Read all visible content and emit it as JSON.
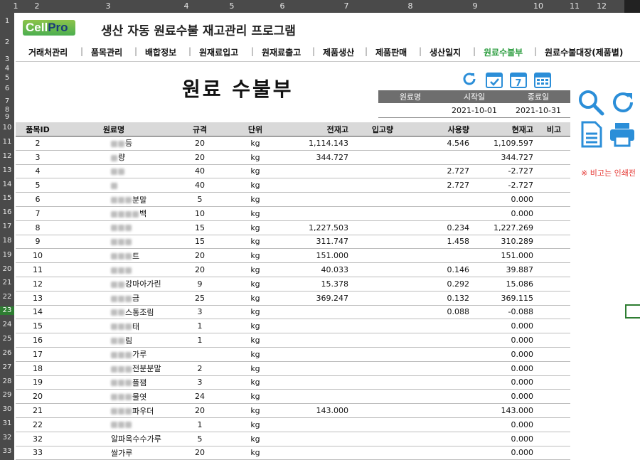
{
  "sheet": {
    "columns": [
      "1",
      "2",
      "3",
      "4",
      "5",
      "6",
      "7",
      "8",
      "9",
      "10",
      "11",
      "12"
    ],
    "rows": [
      "1",
      "2",
      "3",
      "4",
      "5",
      "6",
      "7",
      "8",
      "9",
      "10",
      "11",
      "12",
      "13",
      "14",
      "15",
      "16",
      "17",
      "18",
      "19",
      "20",
      "21",
      "22",
      "23",
      "24",
      "25",
      "26",
      "27",
      "28",
      "29",
      "30",
      "31",
      "32",
      "33"
    ],
    "active_row": "23"
  },
  "app": {
    "logo_prefix": "Cell",
    "logo_suffix": "Pro",
    "title": "생산 자동 원료수불 재고관리 프로그램"
  },
  "menu": [
    {
      "label": "거래처관리"
    },
    {
      "label": "품목관리"
    },
    {
      "label": "배합정보"
    },
    {
      "label": "원재료입고"
    },
    {
      "label": "원재료출고"
    },
    {
      "label": "제품생산"
    },
    {
      "label": "제품판매"
    },
    {
      "label": "생산일지"
    },
    {
      "label": "원료수불부",
      "active": true
    },
    {
      "label": "원료수불대장(제품별)"
    }
  ],
  "page": {
    "title": "원료 수불부",
    "period": {
      "headers": [
        "원료명",
        "시작일",
        "종료일"
      ],
      "start": "2021-10-01",
      "end": "2021-10-31"
    },
    "note": "※ 비고는 인쇄전"
  },
  "table": {
    "headers": [
      "품목ID",
      "원료명",
      "규격",
      "단위",
      "전재고",
      "입고량",
      "사용량",
      "현재고",
      "비고"
    ],
    "rows": [
      {
        "id": "2",
        "name": "등",
        "blur": 2,
        "spec": "20",
        "unit": "kg",
        "prev": "1,114.143",
        "in": "",
        "used": "4.546",
        "cur": "1,109.597"
      },
      {
        "id": "3",
        "name": "량",
        "blur": 1,
        "spec": "20",
        "unit": "kg",
        "prev": "344.727",
        "in": "",
        "used": "",
        "cur": "344.727"
      },
      {
        "id": "4",
        "name": "",
        "blur": 2,
        "spec": "40",
        "unit": "kg",
        "prev": "",
        "in": "",
        "used": "2.727",
        "cur": "-2.727"
      },
      {
        "id": "5",
        "name": "",
        "blur": 1,
        "spec": "40",
        "unit": "kg",
        "prev": "",
        "in": "",
        "used": "2.727",
        "cur": "-2.727"
      },
      {
        "id": "6",
        "name": "분말",
        "blur": 3,
        "spec": "5",
        "unit": "kg",
        "prev": "",
        "in": "",
        "used": "",
        "cur": "0.000"
      },
      {
        "id": "7",
        "name": "백",
        "blur": 4,
        "spec": "10",
        "unit": "kg",
        "prev": "",
        "in": "",
        "used": "",
        "cur": "0.000"
      },
      {
        "id": "8",
        "name": "",
        "blur": 3,
        "spec": "15",
        "unit": "kg",
        "prev": "1,227.503",
        "in": "",
        "used": "0.234",
        "cur": "1,227.269"
      },
      {
        "id": "9",
        "name": "",
        "blur": 3,
        "spec": "15",
        "unit": "kg",
        "prev": "311.747",
        "in": "",
        "used": "1.458",
        "cur": "310.289"
      },
      {
        "id": "10",
        "name": "트",
        "blur": 3,
        "spec": "20",
        "unit": "kg",
        "prev": "151.000",
        "in": "",
        "used": "",
        "cur": "151.000"
      },
      {
        "id": "11",
        "name": "",
        "blur": 3,
        "spec": "20",
        "unit": "kg",
        "prev": "40.033",
        "in": "",
        "used": "0.146",
        "cur": "39.887"
      },
      {
        "id": "12",
        "name": "강마아가린",
        "blur": 2,
        "spec": "9",
        "unit": "kg",
        "prev": "15.378",
        "in": "",
        "used": "0.292",
        "cur": "15.086"
      },
      {
        "id": "13",
        "name": "금",
        "blur": 3,
        "spec": "25",
        "unit": "kg",
        "prev": "369.247",
        "in": "",
        "used": "0.132",
        "cur": "369.115"
      },
      {
        "id": "14",
        "name": "스통조림",
        "blur": 2,
        "spec": "3",
        "unit": "kg",
        "prev": "",
        "in": "",
        "used": "0.088",
        "cur": "-0.088"
      },
      {
        "id": "15",
        "name": "태",
        "blur": 3,
        "spec": "1",
        "unit": "kg",
        "prev": "",
        "in": "",
        "used": "",
        "cur": "0.000"
      },
      {
        "id": "16",
        "name": "림",
        "blur": 2,
        "spec": "1",
        "unit": "kg",
        "prev": "",
        "in": "",
        "used": "",
        "cur": "0.000"
      },
      {
        "id": "17",
        "name": "가루",
        "blur": 3,
        "spec": "",
        "unit": "kg",
        "prev": "",
        "in": "",
        "used": "",
        "cur": "0.000"
      },
      {
        "id": "18",
        "name": "전분분말",
        "blur": 3,
        "spec": "2",
        "unit": "kg",
        "prev": "",
        "in": "",
        "used": "",
        "cur": "0.000"
      },
      {
        "id": "19",
        "name": "플잼",
        "blur": 3,
        "spec": "3",
        "unit": "kg",
        "prev": "",
        "in": "",
        "used": "",
        "cur": "0.000"
      },
      {
        "id": "20",
        "name": "물엿",
        "blur": 3,
        "spec": "24",
        "unit": "kg",
        "prev": "",
        "in": "",
        "used": "",
        "cur": "0.000"
      },
      {
        "id": "21",
        "name": "파우더",
        "blur": 3,
        "spec": "20",
        "unit": "kg",
        "prev": "143.000",
        "in": "",
        "used": "",
        "cur": "143.000"
      },
      {
        "id": "22",
        "name": "",
        "blur": 3,
        "spec": "1",
        "unit": "kg",
        "prev": "",
        "in": "",
        "used": "",
        "cur": "0.000"
      },
      {
        "id": "32",
        "name": "알파옥수수가루",
        "blur": 0,
        "spec": "5",
        "unit": "kg",
        "prev": "",
        "in": "",
        "used": "",
        "cur": "0.000"
      },
      {
        "id": "33",
        "name": "쌀가루",
        "blur": 0,
        "spec": "20",
        "unit": "kg",
        "prev": "",
        "in": "",
        "used": "",
        "cur": "0.000"
      }
    ]
  },
  "colors": {
    "accent_blue": "#2b8ed8",
    "active_menu": "#2e9e41",
    "note_red": "#e53935",
    "chrome": "#4a4a4a"
  },
  "icons": [
    "refresh-icon",
    "calendar-check-icon",
    "calendar-7-icon",
    "calendar-icon",
    "search-icon",
    "refresh-large-icon",
    "document-icon",
    "print-icon"
  ]
}
